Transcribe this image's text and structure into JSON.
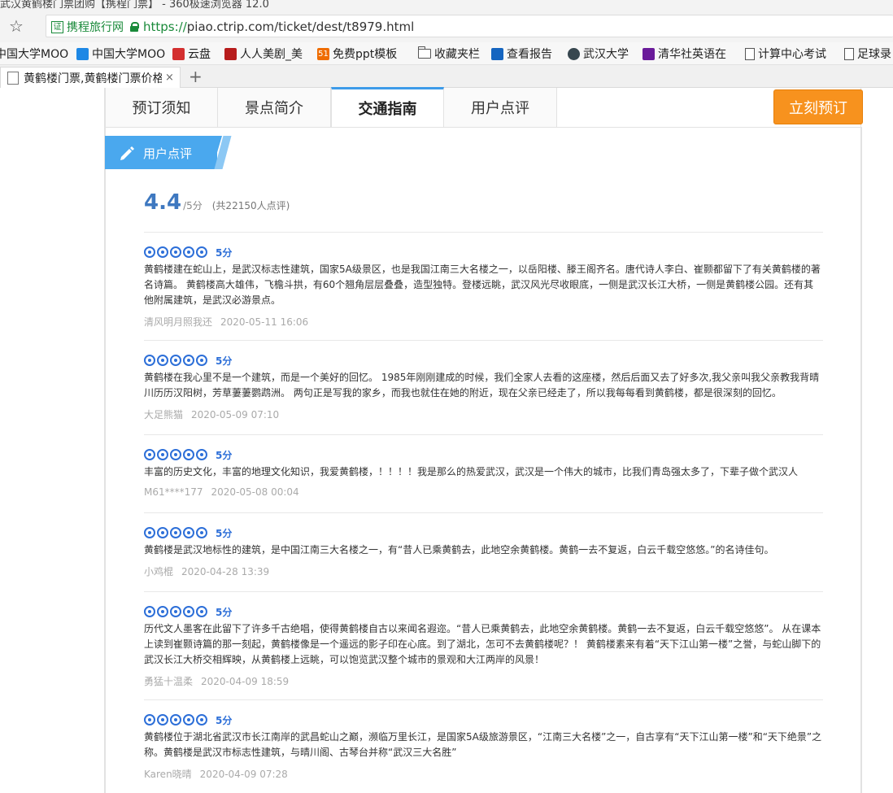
{
  "browser": {
    "window_title": "武汉黄鹤楼门票团购【携程门票】 - 360极速浏览器 12.0",
    "cert_label": "携程旅行网",
    "cert_badge": "证",
    "url_scheme": "https://",
    "url_rest": "piao.ctrip.com/ticket/dest/t8979.html",
    "bookmarks": [
      {
        "label": "中国大学MOO",
        "icon": "mooc-icon",
        "color": "#e53935"
      },
      {
        "label": "中国大学MOO",
        "icon": "book-icon",
        "color": "#1e88e5"
      },
      {
        "label": "云盘",
        "icon": "cloud-icon",
        "color": "#d32f2f"
      },
      {
        "label": "人人美剧_美",
        "icon": "rr-icon",
        "color": "#b71c1c"
      },
      {
        "label": "免费ppt模板",
        "icon": "ppt-icon",
        "color": "#ef6c00"
      },
      {
        "label": "收藏夹栏",
        "icon": "folder-icon",
        "color": "#555"
      },
      {
        "label": "查看报告",
        "icon": "report-icon",
        "color": "#1565c0"
      },
      {
        "label": "武汉大学",
        "icon": "whu-icon",
        "color": "#1b5e20"
      },
      {
        "label": "清华社英语在",
        "icon": "tsinghua-icon",
        "color": "#6a1b9a"
      },
      {
        "label": "计算中心考试",
        "icon": "page-icon",
        "color": "#555"
      },
      {
        "label": "足球录",
        "icon": "page-icon",
        "color": "#555"
      }
    ],
    "tab_title": "黄鹤楼门票,黄鹤楼门票价格",
    "tab_close": "×",
    "new_tab": "+"
  },
  "nav": {
    "tabs": [
      {
        "label": "预订须知"
      },
      {
        "label": "景点简介"
      },
      {
        "label": "交通指南"
      },
      {
        "label": "用户点评"
      }
    ],
    "active_tab": "交通指南",
    "book_button": "立刻预订"
  },
  "section": {
    "title": "用户点评"
  },
  "summary": {
    "score": "4.4",
    "unit": "/5分",
    "count": "(共22150人点评)"
  },
  "reviews": [
    {
      "rating": "5分",
      "text": "黄鹤楼建在蛇山上，是武汉标志性建筑，国家5A级景区，也是我国江南三大名楼之一，以岳阳楼、滕王阁齐名。唐代诗人李白、崔颢都留下了有关黄鹤楼的著名诗篇。 黄鹤楼高大雄伟，飞檐斗拱，有60个翘角层层叠叠，造型独特。登楼远眺，武汉风光尽收眼底，一侧是武汉长江大桥，一侧是黄鹤楼公园。还有其他附属建筑，是武汉必游景点。",
      "user": "清风明月照我还",
      "date": "2020-05-11 16:06"
    },
    {
      "rating": "5分",
      "text": "黄鹤楼在我心里不是一个建筑，而是一个美好的回忆。 1985年刚刚建成的时候，我们全家人去看的这座楼，然后后面又去了好多次,我父亲叫我父亲教我背晴川历历汉阳树，芳草萋萋鹦鹉洲。 两句正是写我的家乡，而我也就住在她的附近，现在父亲已经走了，所以我每每看到黄鹤楼，都是很深刻的回忆。",
      "user": "大足熊猫",
      "date": "2020-05-09 07:10"
    },
    {
      "rating": "5分",
      "text": "丰富的历史文化，丰富的地理文化知识，我爱黄鹤楼，！！！！我是那么的热爱武汉，武汉是一个伟大的城市，比我们青岛强太多了，下辈子做个武汉人",
      "user": "M61****177",
      "date": "2020-05-08 00:04"
    },
    {
      "rating": "5分",
      "text": "黄鹤楼是武汉地标性的建筑，是中国江南三大名楼之一，有“昔人已乘黄鹤去，此地空余黄鹤楼。黄鹤一去不复返，白云千载空悠悠。”的名诗佳句。",
      "user": "小鸡棍",
      "date": "2020-04-28 13:39"
    },
    {
      "rating": "5分",
      "text": "历代文人墨客在此留下了许多千古绝唱，使得黄鹤楼自古以来闻名遐迩。“昔人已乘黄鹤去，此地空余黄鹤楼。黄鹤一去不复返，白云千载空悠悠”。 从在课本上读到崔颢诗篇的那一刻起，黄鹤楼像是一个遥远的影子印在心底。到了湖北，怎可不去黄鹤楼呢？！ 黄鹤楼素来有着“天下江山第一楼”之誉，与蛇山脚下的武汉长江大桥交相辉映，从黄鹤楼上远眺，可以饱览武汉整个城市的景观和大江两岸的风景！",
      "user": "勇猛十温柔",
      "date": "2020-04-09 18:59"
    },
    {
      "rating": "5分",
      "text": "黄鹤楼位于湖北省武汉市长江南岸的武昌蛇山之巅，濒临万里长江，是国家5A级旅游景区，“江南三大名楼”之一，自古享有“天下江山第一楼”和“天下绝景”之称。黄鹤楼是武汉市标志性建筑，与晴川阁、古琴台并称“武汉三大名胜”",
      "user": "Karen晓晴",
      "date": "2020-04-09 07:28"
    }
  ]
}
